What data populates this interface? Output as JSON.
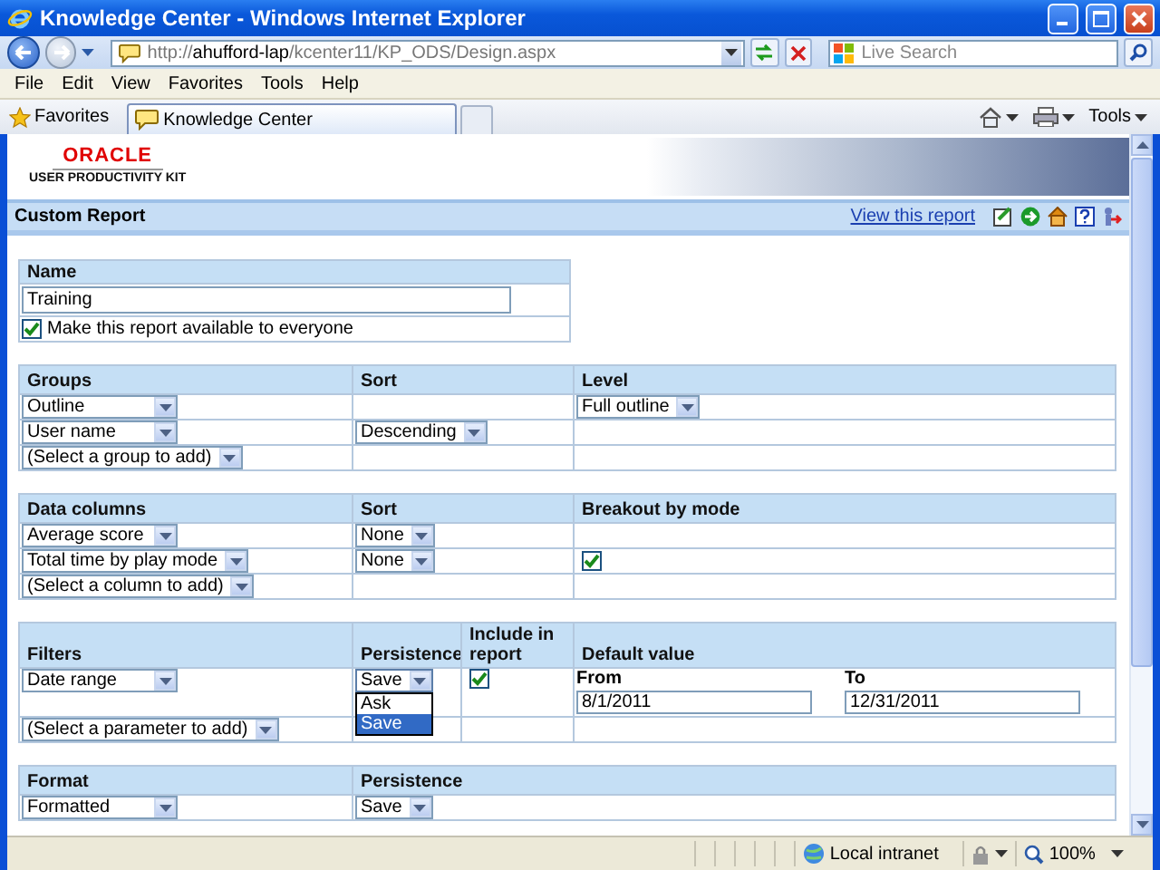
{
  "window": {
    "title": "Knowledge Center - Windows Internet Explorer"
  },
  "address_bar": {
    "url_prefix": "http://",
    "url_host": "ahufford-lap",
    "url_path": "/kcenter11/KP_ODS/Design.aspx"
  },
  "search": {
    "placeholder": "Live Search"
  },
  "menu": [
    "File",
    "Edit",
    "View",
    "Favorites",
    "Tools",
    "Help"
  ],
  "favorites_button": "Favorites",
  "tabs": [
    {
      "label": "Knowledge Center",
      "selected": true
    }
  ],
  "command_bar": {
    "tools": "Tools"
  },
  "logo": {
    "brand": "ORACLE",
    "product": "USER PRODUCTIVITY KIT"
  },
  "report_bar": {
    "title": "Custom Report",
    "link": "View this report"
  },
  "name_section": {
    "header": "Name",
    "value": "Training",
    "share": {
      "label": "Make this report available to everyone",
      "checked": true
    }
  },
  "sections": [
    {
      "columns": [
        "Groups",
        "Sort",
        "Level"
      ],
      "rows": [
        [
          {
            "kind": "select",
            "value": "Outline"
          },
          {
            "kind": "empty"
          },
          {
            "kind": "select",
            "value": "Full outline"
          }
        ],
        [
          {
            "kind": "select",
            "value": "User name"
          },
          {
            "kind": "select",
            "value": "Descending"
          },
          {
            "kind": "empty"
          }
        ],
        [
          {
            "kind": "select",
            "value": "(Select a group to add)"
          },
          {
            "kind": "empty"
          },
          {
            "kind": "empty"
          }
        ]
      ]
    },
    {
      "columns": [
        "Data columns",
        "Sort",
        "Breakout by mode"
      ],
      "rows": [
        [
          {
            "kind": "select",
            "value": "Average score"
          },
          {
            "kind": "select",
            "value": "None"
          },
          {
            "kind": "empty"
          }
        ],
        [
          {
            "kind": "select",
            "value": "Total time by play mode"
          },
          {
            "kind": "select",
            "value": "None"
          },
          {
            "kind": "checkbox",
            "checked": true
          }
        ],
        [
          {
            "kind": "select",
            "value": "(Select a column to add)"
          },
          {
            "kind": "empty"
          },
          {
            "kind": "empty"
          }
        ]
      ]
    },
    {
      "columns": [
        "Filters",
        "Persistence",
        "Include in report",
        "Default value"
      ],
      "rows": [
        [
          {
            "kind": "select",
            "value": "Date range"
          },
          {
            "kind": "select",
            "value": "Save",
            "expanded": true,
            "options": [
              {
                "label": "Ask",
                "selected": false
              },
              {
                "label": "Save",
                "selected": true
              }
            ]
          },
          {
            "kind": "checkbox",
            "checked": true
          },
          {
            "kind": "daterange",
            "from_label": "From",
            "from": "8/1/2011",
            "to_label": "To",
            "to": "12/31/2011"
          }
        ],
        [
          {
            "kind": "select",
            "value": "(Select a parameter to add)"
          },
          {
            "kind": "empty"
          },
          {
            "kind": "empty"
          },
          {
            "kind": "empty"
          }
        ]
      ]
    },
    {
      "columns": [
        "Format",
        "Persistence"
      ],
      "rows": [
        [
          {
            "kind": "select",
            "value": "Formatted"
          },
          {
            "kind": "select",
            "value": "Save"
          }
        ]
      ]
    }
  ],
  "status_bar": {
    "zone": "Local intranet",
    "zoom": "100%"
  }
}
